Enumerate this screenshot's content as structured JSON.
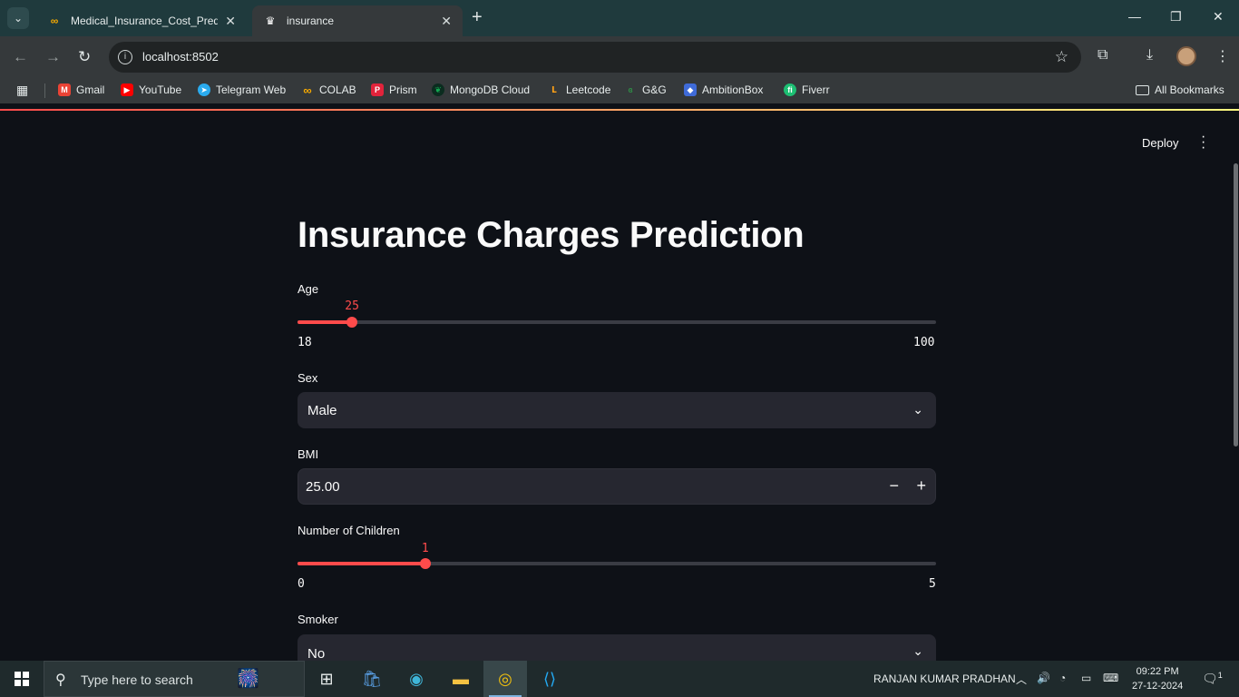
{
  "browser": {
    "tabs": [
      {
        "title": "Medical_Insurance_Cost_Predict",
        "favicon": "colab-icon",
        "active": false
      },
      {
        "title": "insurance",
        "favicon": "streamlit-icon",
        "active": true
      }
    ],
    "url": "localhost:8502",
    "bookmarks": [
      {
        "label": "Gmail",
        "icon": "gmail-icon",
        "color": "#ea4335"
      },
      {
        "label": "YouTube",
        "icon": "youtube-icon",
        "color": "#ff0000"
      },
      {
        "label": "Telegram Web",
        "icon": "telegram-icon",
        "color": "#2aabee"
      },
      {
        "label": "COLAB",
        "icon": "colab-icon",
        "color": "#f9ab00"
      },
      {
        "label": "Prism",
        "icon": "prism-icon",
        "color": "#e2233b"
      },
      {
        "label": "MongoDB Cloud",
        "icon": "mongodb-icon",
        "color": "#13aa52"
      },
      {
        "label": "Leetcode",
        "icon": "leetcode-icon",
        "color": "#ffa116"
      },
      {
        "label": "G&G",
        "icon": "gfg-icon",
        "color": "#2f8d46"
      },
      {
        "label": "AmbitionBox",
        "icon": "ambitionbox-icon",
        "color": "#3f6bd8"
      },
      {
        "label": "Fiverr",
        "icon": "fiverr-icon",
        "color": "#1dbf73"
      }
    ],
    "all_bookmarks": "All Bookmarks"
  },
  "app": {
    "deploy_label": "Deploy",
    "title": "Insurance Charges Prediction",
    "accent": "#ff4b4b",
    "age": {
      "label": "Age",
      "value": 25,
      "min": 18,
      "max": 100
    },
    "sex": {
      "label": "Sex",
      "value": "Male"
    },
    "bmi": {
      "label": "BMI",
      "value": "25.00",
      "minus": "−",
      "plus": "+"
    },
    "children": {
      "label": "Number of Children",
      "value": 1,
      "min": 0,
      "max": 5
    },
    "smoker": {
      "label": "Smoker",
      "value": "No"
    }
  },
  "taskbar": {
    "search_placeholder": "Type here to search",
    "user": "RANJAN KUMAR PRADHAN",
    "time": "09:22 PM",
    "date": "27-12-2024",
    "notification_count": "1"
  }
}
